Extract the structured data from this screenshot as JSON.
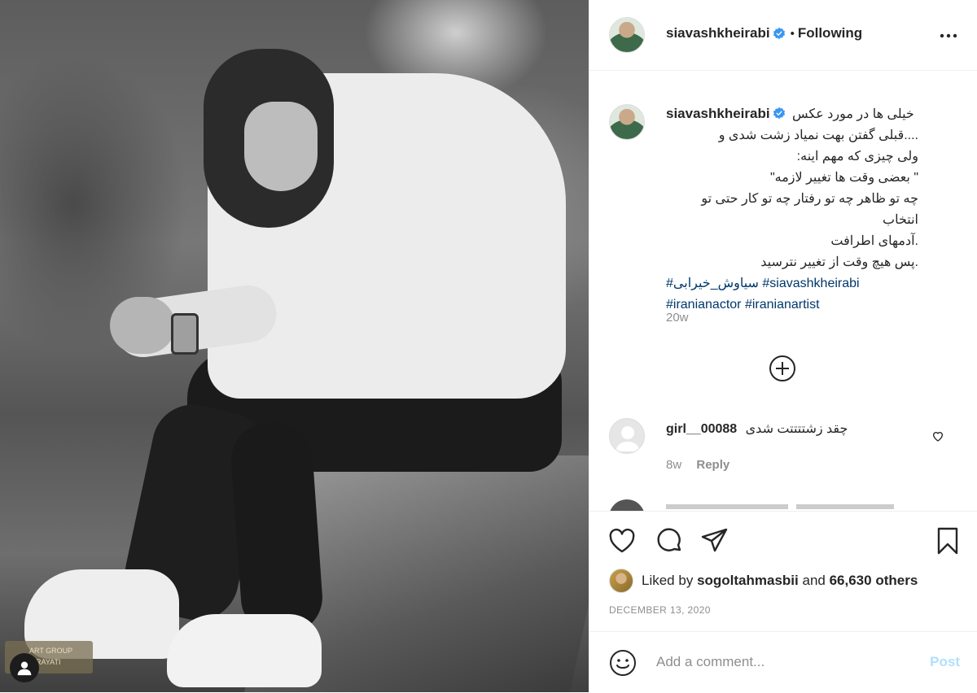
{
  "photo": {
    "watermark_lines": [
      "ART GROUP",
      "A RAYATI"
    ]
  },
  "header": {
    "username": "siavashkheirabi",
    "separator": "•",
    "follow_status": "Following"
  },
  "caption": {
    "username": "siavashkheirabi",
    "first_line": "خیلی ها در مورد عکس",
    "lines": [
      "....قبلی گفتن بهت نمیاد زشت شدی و",
      "ولی چیزی که مهم اینه:",
      "\" بعضی وقت ها تغییر لازمه\"",
      "چه تو ظاهر چه تو رفتار چه تو کار حتی تو انتخاب",
      ".آدمهای اطرافت",
      ".پس هیچ وقت از تغییر نترسید"
    ],
    "hashtags_line1": "#سیاوش_خیرابی #siavashkheirabi",
    "hashtags_line2": "#iranianactor #iranianartist",
    "time": "20w"
  },
  "comment": {
    "username": "girl__00088",
    "text": "چقد زشتتتتت شدی",
    "time": "8w",
    "reply_label": "Reply"
  },
  "likes": {
    "prefix": "Liked by",
    "user": "sogoltahmasbii",
    "middle": "and",
    "count": "66,630 others"
  },
  "date": "DECEMBER 13, 2020",
  "add_comment": {
    "placeholder": "Add a comment...",
    "post_label": "Post"
  }
}
